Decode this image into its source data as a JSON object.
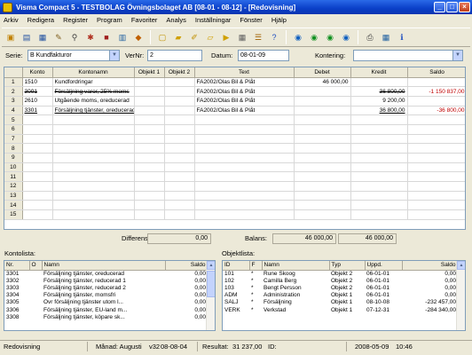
{
  "window": {
    "title": "Visma Compact 5 - TESTBOLAG Övningsbolaget AB [08-01 - 08-12] - [Redovisning]"
  },
  "menu": [
    "Arkiv",
    "Redigera",
    "Register",
    "Program",
    "Favoriter",
    "Analys",
    "Inställningar",
    "Fönster",
    "Hjälp"
  ],
  "filter": {
    "serie_label": "Serie:",
    "serie_value": "B Kundfakturor",
    "vernr_label": "VerNr:",
    "vernr_value": "2",
    "datum_label": "Datum:",
    "datum_value": "08-01-09",
    "kontering_label": "Kontering:",
    "kontering_value": ""
  },
  "grid": {
    "headers": [
      "Konto",
      "Kontonamn",
      "Objekt 1",
      "Objekt 2",
      "Text",
      "Debet",
      "Kredit",
      "Saldo"
    ],
    "rows": [
      {
        "n": "1",
        "konto": "1510",
        "namn": "Kundfordringar",
        "o1": "",
        "o2": "",
        "text": "FA2002/Olas Bil & Plåt",
        "debet": "46 000,00",
        "kredit": "",
        "saldo": "",
        "strike": false
      },
      {
        "n": "2",
        "konto": "3001",
        "namn": "Försäljning varor, 25% moms",
        "o1": "",
        "o2": "",
        "text": "FA2002/Olas Bil & Plåt",
        "debet": "",
        "kredit": "36 800,00",
        "saldo": "-1 150 837,00",
        "strike": true
      },
      {
        "n": "3",
        "konto": "2610",
        "namn": "Utgående moms, oreducerad",
        "o1": "",
        "o2": "",
        "text": "FA2002/Olas Bil & Plåt",
        "debet": "",
        "kredit": "9 200,00",
        "saldo": "",
        "strike": false
      },
      {
        "n": "4",
        "konto": "3301",
        "namn": "Försäljning tjänster, oreducerad",
        "o1": "",
        "o2": "",
        "text": "FA2002/Olas Bil & Plåt",
        "debet": "",
        "kredit": "36 800,00",
        "saldo": "-36 800,00",
        "strike": false,
        "underline": true
      },
      {
        "n": "5"
      },
      {
        "n": "6"
      },
      {
        "n": "7"
      },
      {
        "n": "8"
      },
      {
        "n": "9"
      },
      {
        "n": "10"
      },
      {
        "n": "11"
      },
      {
        "n": "12"
      },
      {
        "n": "13"
      },
      {
        "n": "14"
      },
      {
        "n": "15"
      }
    ]
  },
  "totals": {
    "differens_label": "Differens:",
    "differens_value": "0,00",
    "balans_label": "Balans:",
    "debet_total": "46 000,00",
    "kredit_total": "46 000,00"
  },
  "kontolista": {
    "title": "Kontolista:",
    "headers": [
      "Nr.",
      "O",
      "Namn",
      "Saldo"
    ],
    "rows": [
      {
        "nr": "3301",
        "o": "",
        "namn": "Försäljning tjänster, oreducerad",
        "saldo": "0,00"
      },
      {
        "nr": "3302",
        "o": "",
        "namn": "Försäljning tjänster, reducerad 1",
        "saldo": "0,00"
      },
      {
        "nr": "3303",
        "o": "",
        "namn": "Försäljning tjänster, reducerad 2",
        "saldo": "0,00"
      },
      {
        "nr": "3304",
        "o": "",
        "namn": "Försäljning tjänster, momsfri",
        "saldo": "0,00"
      },
      {
        "nr": "3305",
        "o": "",
        "namn": "Övr försäljning tjänster utom l...",
        "saldo": "0,00"
      },
      {
        "nr": "3306",
        "o": "",
        "namn": "Försäljning tjänster, EU-land m...",
        "saldo": "0,00"
      },
      {
        "nr": "3308",
        "o": "",
        "namn": "Försäljning tjänster, köpare sk...",
        "saldo": "0,00"
      }
    ]
  },
  "objektlista": {
    "title": "Objektlista:",
    "headers": [
      "ID",
      "F",
      "Namn",
      "Typ",
      "Uppd.",
      "Saldo"
    ],
    "rows": [
      {
        "id": "101",
        "f": "*",
        "namn": "Rune Skoog",
        "typ": "Objekt 2",
        "uppd": "06-01-01",
        "saldo": "0,00"
      },
      {
        "id": "102",
        "f": "*",
        "namn": "Camilla Berg",
        "typ": "Objekt 2",
        "uppd": "06-01-01",
        "saldo": "0,00"
      },
      {
        "id": "103",
        "f": "*",
        "namn": "Bengt Persson",
        "typ": "Objekt 2",
        "uppd": "06-01-01",
        "saldo": "0,00"
      },
      {
        "id": "ADM",
        "f": "*",
        "namn": "Administration",
        "typ": "Objekt 1",
        "uppd": "06-01-01",
        "saldo": "0,00"
      },
      {
        "id": "SÄLJ",
        "f": "*",
        "namn": "Försäljning",
        "typ": "Objekt 1",
        "uppd": "08-10-08",
        "saldo": "-232 457,00"
      },
      {
        "id": "VERK",
        "f": "*",
        "namn": "Verkstad",
        "typ": "Objekt 1",
        "uppd": "07-12-31",
        "saldo": "-284 340,00"
      }
    ]
  },
  "status": {
    "mode": "Redovisning",
    "month": "Månad: Augusti",
    "version": "v32",
    "vdate": "08-08-04",
    "result": "Resultat:",
    "result_value": "31 237,00",
    "id_label": "ID:",
    "date": "2008-05-09",
    "time": "10:46"
  },
  "icons": {
    "accent": "#0a3fc8",
    "red_text": "#c00000"
  }
}
